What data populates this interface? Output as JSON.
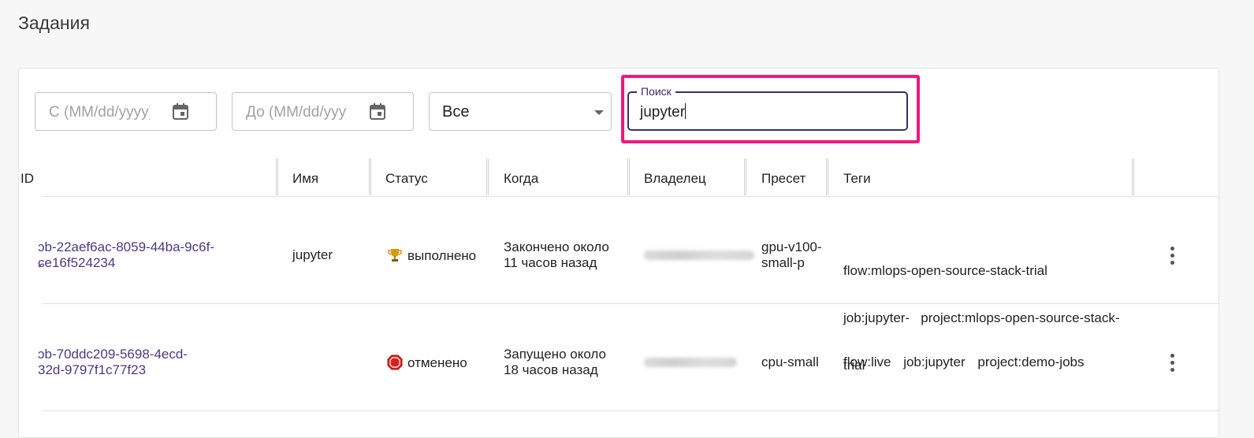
{
  "page": {
    "title": "Задания"
  },
  "filters": {
    "from_placeholder": "С (MM/dd/yyyy)",
    "to_placeholder": "До (MM/dd/yyyy)",
    "status_select": "Все",
    "search_label": "Поиск",
    "search_value": "jupyter"
  },
  "table": {
    "columns": [
      "ID",
      "Имя",
      "Статус",
      "Когда",
      "Владелец",
      "Пресет",
      "Теги"
    ],
    "rows": [
      {
        "id_line1": "ɔb-22aef6ac-8059-44ba-9c6f-",
        "id_line2": "ɕe16f524234",
        "name": "jupyter",
        "status": "выполнено",
        "status_icon": "trophy-icon",
        "when_line1": "Закончено около",
        "when_line2": "11 часов назад",
        "preset_line1": "gpu-v100-",
        "preset_line2": "small-p",
        "tags_line1": "flow:mlops-open-source-stack-trial",
        "tags_line2": "job:jupyter-   project:mlops-open-source-stack-",
        "tags_line3": "trial"
      },
      {
        "id_line1": "ɔb-70ddc209-5698-4ecd-",
        "id_line2": "32d-9797f1c77f23",
        "name": "",
        "status": "отменено",
        "status_icon": "stop-icon",
        "when_line1": "Запущено около",
        "when_line2": "18 часов назад",
        "preset_line1": "cpu-small",
        "preset_line2": "",
        "tags": [
          "flow:live",
          "job:jupyter",
          "project:demo-jobs"
        ]
      }
    ]
  },
  "colors": {
    "accent": "#3b2c6e",
    "highlight": "#f2177e",
    "link": "#4a3a84"
  }
}
